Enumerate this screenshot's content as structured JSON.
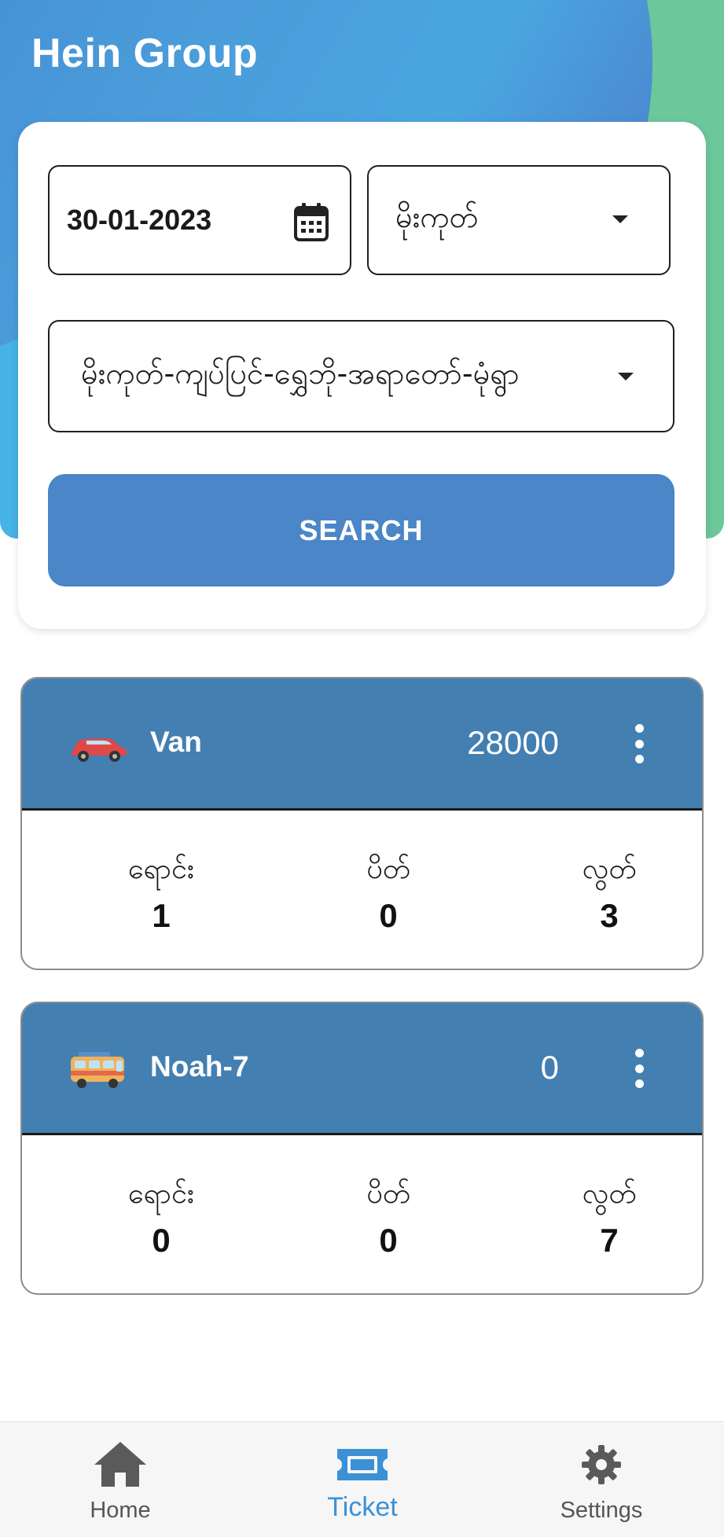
{
  "app": {
    "title": "Hein Group"
  },
  "search": {
    "date": "30-01-2023",
    "from": "မိုးကုတ်",
    "route": "မိုးကုတ်-ကျပ်ပြင်-ရွှေဘို-အရာတော်-မုံရွာ",
    "button_label": "SEARCH"
  },
  "vehicles": [
    {
      "name": "Van",
      "price": "28000",
      "icon": "car-icon",
      "stats": [
        {
          "label": "ရောင်း",
          "value": "1"
        },
        {
          "label": "ပိတ်",
          "value": "0"
        },
        {
          "label": "လွတ်",
          "value": "3"
        }
      ]
    },
    {
      "name": "Noah-7",
      "price": "0",
      "icon": "minibus-icon",
      "stats": [
        {
          "label": "ရောင်း",
          "value": "0"
        },
        {
          "label": "ပိတ်",
          "value": "0"
        },
        {
          "label": "လွတ်",
          "value": "7"
        }
      ]
    }
  ],
  "nav": {
    "items": [
      {
        "label": "Home",
        "icon": "home-icon"
      },
      {
        "label": "Ticket",
        "icon": "ticket-icon"
      },
      {
        "label": "Settings",
        "icon": "gear-icon"
      }
    ],
    "active": "Ticket"
  },
  "colors": {
    "header_blue": "#4a9bd9",
    "header_green": "#6cc79a",
    "button": "#4a86c8",
    "card_header": "#447fb1",
    "nav_active": "#3c91d6"
  }
}
